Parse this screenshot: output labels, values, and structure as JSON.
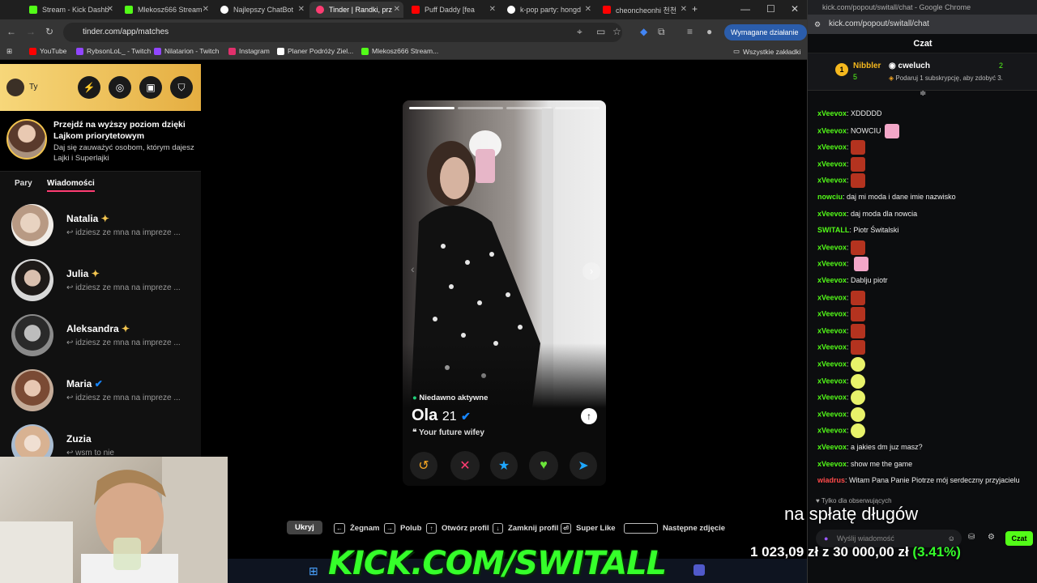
{
  "browser": {
    "tabs": [
      {
        "label": "Stream - Kick Dashb",
        "color": "#53fc18"
      },
      {
        "label": "Mlekosz666 Stream",
        "color": "#53fc18"
      },
      {
        "label": "Najlepszy ChatBot",
        "color": "#ffffff"
      },
      {
        "label": "Tinder | Randki, prz",
        "color": "#fe3c72"
      },
      {
        "label": "Puff Daddy [fea",
        "color": "#ff0000"
      },
      {
        "label": "k-pop party: hongd",
        "color": "#ffffff"
      },
      {
        "label": "cheoncheonhi 천천",
        "color": "#ff0000"
      }
    ],
    "url": "tinder.com/app/matches",
    "action_button": "Wymagane działanie",
    "bookmarks": [
      "YouTube",
      "RybsonLoL_ - Twitch",
      "Nilatarion - Twitch",
      "Instagram",
      "Planer Podróży Ziel...",
      "Mlekosz666 Stream..."
    ],
    "all_bookmarks": "Wszystkie zakładki"
  },
  "tinder": {
    "user_label": "Ty",
    "promo_title": "Przejdź na wyższy poziom dzięki Lajkom priorytetowym",
    "promo_sub": "Daj się zauważyć osobom, którym dajesz Lajki i Superlajki",
    "tabs": [
      "Pary",
      "Wiadomości"
    ],
    "matches": [
      {
        "name": "Natalia",
        "msg": "idziesz ze mna na impreze ..."
      },
      {
        "name": "Julia",
        "msg": "idziesz ze mna na impreze ..."
      },
      {
        "name": "Aleksandra",
        "msg": "idziesz ze mna na impreze ..."
      },
      {
        "name": "Maria",
        "msg": "idziesz ze mna na impreze ..."
      },
      {
        "name": "Zuzia",
        "msg": "wsm to nie"
      }
    ],
    "card": {
      "status": "Niedawno aktywne",
      "name": "Ola",
      "age": "21",
      "bio": "Your future wifey"
    },
    "hints": [
      {
        "key": "",
        "label": "Ukryj"
      },
      {
        "key": "←",
        "label": "Żegnam"
      },
      {
        "key": "→",
        "label": "Polub"
      },
      {
        "key": "↑",
        "label": "Otwórz profil"
      },
      {
        "key": "↓",
        "label": "Zamknij profil"
      },
      {
        "key": "⏎",
        "label": "Super Like"
      },
      {
        "key": " ",
        "label": "Następne zdjęcie"
      }
    ]
  },
  "chat": {
    "window_title": "kick.com/popout/switall/chat - Google Chrome",
    "url": "kick.com/popout/switall/chat",
    "header": "Czat",
    "pinned": {
      "user1": "Nibbler",
      "user1_count": "5",
      "user2": "cweluch",
      "user2_count": "2",
      "sub_text": "Podaruj 1 subskrypcję, aby zdobyć 3."
    },
    "messages": [
      {
        "user": "xVeevox",
        "text": "XDDDDD",
        "color": "#53fc18",
        "emote": ""
      },
      {
        "user": "xVeevox",
        "text": "NOWCIU",
        "color": "#53fc18",
        "emote": "pink"
      },
      {
        "user": "xVeevox",
        "text": "",
        "color": "#53fc18",
        "emote": "red"
      },
      {
        "user": "xVeevox",
        "text": "",
        "color": "#53fc18",
        "emote": "red"
      },
      {
        "user": "xVeevox",
        "text": "",
        "color": "#53fc18",
        "emote": "red"
      },
      {
        "user": "nowciu",
        "text": "daj mi moda i dane imie nazwisko",
        "color": "#53fc18",
        "emote": ""
      },
      {
        "user": "xVeevox",
        "text": "daj moda dla nowcia",
        "color": "#53fc18",
        "emote": ""
      },
      {
        "user": "SWITALL",
        "text": "Piotr Świtalski",
        "color": "#53fc18",
        "emote": ""
      },
      {
        "user": "xVeevox",
        "text": "",
        "color": "#53fc18",
        "emote": "red"
      },
      {
        "user": "xVeevox",
        "text": "",
        "color": "#53fc18",
        "emote": "pink"
      },
      {
        "user": "xVeevox",
        "text": "Dablju piotr",
        "color": "#53fc18",
        "emote": ""
      },
      {
        "user": "xVeevox",
        "text": "",
        "color": "#53fc18",
        "emote": "red"
      },
      {
        "user": "xVeevox",
        "text": "",
        "color": "#53fc18",
        "emote": "red"
      },
      {
        "user": "xVeevox",
        "text": "",
        "color": "#53fc18",
        "emote": "red"
      },
      {
        "user": "xVeevox",
        "text": "",
        "color": "#53fc18",
        "emote": "red"
      },
      {
        "user": "xVeevox",
        "text": "",
        "color": "#53fc18",
        "emote": "smile"
      },
      {
        "user": "xVeevox",
        "text": "",
        "color": "#53fc18",
        "emote": "smile"
      },
      {
        "user": "xVeevox",
        "text": "",
        "color": "#53fc18",
        "emote": "smile"
      },
      {
        "user": "xVeevox",
        "text": "",
        "color": "#53fc18",
        "emote": "smile"
      },
      {
        "user": "xVeevox",
        "text": "",
        "color": "#53fc18",
        "emote": "smile"
      },
      {
        "user": "xVeevox",
        "text": "a jakies dm juz masz?",
        "color": "#53fc18",
        "emote": ""
      },
      {
        "user": "xVeevox",
        "text": "show me the game",
        "color": "#53fc18",
        "emote": ""
      },
      {
        "user": "wiadrus",
        "text": "Witam Pana Panie Piotrze mój serdeczny przyjacielu",
        "color": "#ff4a4a",
        "emote": ""
      }
    ],
    "followers_only": "Tylko dla obserwujących",
    "input_placeholder": "Wyślij wiadomość",
    "send_label": "Czat"
  },
  "overlay": {
    "debt_title": "na spłatę długów",
    "goal_current": "1 023,09 zł",
    "goal_sep": "z",
    "goal_target": "30 000,00 zł",
    "goal_pct": "(3.41%)",
    "banner": "KICK.COM/SWITALL"
  }
}
